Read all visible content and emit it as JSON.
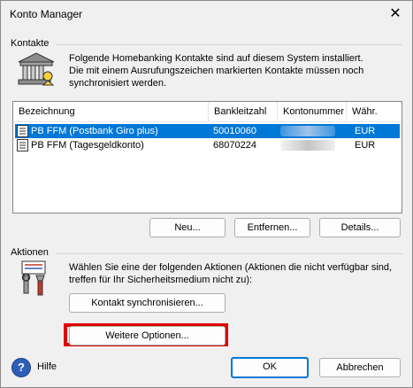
{
  "window": {
    "title": "Konto Manager",
    "close_glyph": "✕"
  },
  "contacts": {
    "group_label": "Kontakte",
    "icon": "bank-building-icon",
    "info_line1": "Folgende Homebanking Kontakte sind auf diesem System installiert.",
    "info_line2": "Die mit einem Ausrufungszeichen markierten Kontakte müssen noch",
    "info_line3": "synchronisiert werden.",
    "columns": [
      "Bezeichnung",
      "Bankleitzahl",
      "Kontonummer",
      "Währ."
    ],
    "rows": [
      {
        "name": "PB FFM  (Postbank Giro plus)",
        "blz": "50010060",
        "currency": "EUR",
        "selected": true
      },
      {
        "name": "PB FFM  (Tagesgeldkonto)",
        "blz": "68070224",
        "currency": "EUR",
        "selected": false
      }
    ],
    "buttons": {
      "new": "Neu...",
      "remove": "Entfernen...",
      "details": "Details..."
    }
  },
  "actions": {
    "group_label": "Aktionen",
    "icon": "tools-icon",
    "text_line1": "Wählen Sie eine der folgenden Aktionen (Aktionen die nicht verfügbar sind,",
    "text_line2": "treffen für Ihr Sicherheitsmedium nicht zu):",
    "sync_button": "Kontakt synchronisieren...",
    "more_options_button": "Weitere Optionen..."
  },
  "footer": {
    "help_label": "Hilfe",
    "help_glyph": "?",
    "ok": "OK",
    "cancel": "Abbrechen"
  },
  "colors": {
    "selection": "#0078d7",
    "highlight_box": "#e00000"
  }
}
